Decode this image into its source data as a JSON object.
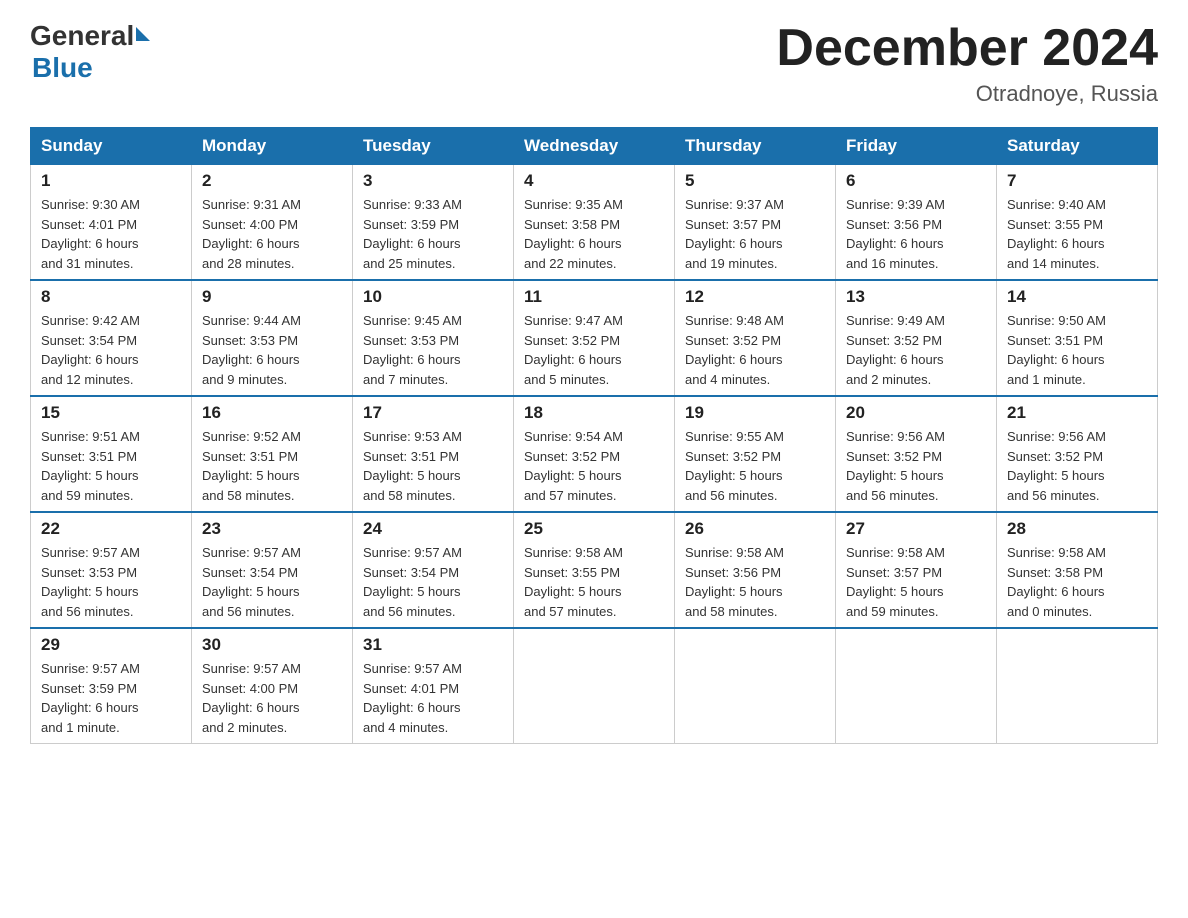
{
  "header": {
    "logo_general": "General",
    "logo_blue": "Blue",
    "month_title": "December 2024",
    "location": "Otradnoye, Russia"
  },
  "weekdays": [
    "Sunday",
    "Monday",
    "Tuesday",
    "Wednesday",
    "Thursday",
    "Friday",
    "Saturday"
  ],
  "weeks": [
    [
      {
        "day": "1",
        "sunrise": "9:30 AM",
        "sunset": "4:01 PM",
        "daylight": "6 hours and 31 minutes."
      },
      {
        "day": "2",
        "sunrise": "9:31 AM",
        "sunset": "4:00 PM",
        "daylight": "6 hours and 28 minutes."
      },
      {
        "day": "3",
        "sunrise": "9:33 AM",
        "sunset": "3:59 PM",
        "daylight": "6 hours and 25 minutes."
      },
      {
        "day": "4",
        "sunrise": "9:35 AM",
        "sunset": "3:58 PM",
        "daylight": "6 hours and 22 minutes."
      },
      {
        "day": "5",
        "sunrise": "9:37 AM",
        "sunset": "3:57 PM",
        "daylight": "6 hours and 19 minutes."
      },
      {
        "day": "6",
        "sunrise": "9:39 AM",
        "sunset": "3:56 PM",
        "daylight": "6 hours and 16 minutes."
      },
      {
        "day": "7",
        "sunrise": "9:40 AM",
        "sunset": "3:55 PM",
        "daylight": "6 hours and 14 minutes."
      }
    ],
    [
      {
        "day": "8",
        "sunrise": "9:42 AM",
        "sunset": "3:54 PM",
        "daylight": "6 hours and 12 minutes."
      },
      {
        "day": "9",
        "sunrise": "9:44 AM",
        "sunset": "3:53 PM",
        "daylight": "6 hours and 9 minutes."
      },
      {
        "day": "10",
        "sunrise": "9:45 AM",
        "sunset": "3:53 PM",
        "daylight": "6 hours and 7 minutes."
      },
      {
        "day": "11",
        "sunrise": "9:47 AM",
        "sunset": "3:52 PM",
        "daylight": "6 hours and 5 minutes."
      },
      {
        "day": "12",
        "sunrise": "9:48 AM",
        "sunset": "3:52 PM",
        "daylight": "6 hours and 4 minutes."
      },
      {
        "day": "13",
        "sunrise": "9:49 AM",
        "sunset": "3:52 PM",
        "daylight": "6 hours and 2 minutes."
      },
      {
        "day": "14",
        "sunrise": "9:50 AM",
        "sunset": "3:51 PM",
        "daylight": "6 hours and 1 minute."
      }
    ],
    [
      {
        "day": "15",
        "sunrise": "9:51 AM",
        "sunset": "3:51 PM",
        "daylight": "5 hours and 59 minutes."
      },
      {
        "day": "16",
        "sunrise": "9:52 AM",
        "sunset": "3:51 PM",
        "daylight": "5 hours and 58 minutes."
      },
      {
        "day": "17",
        "sunrise": "9:53 AM",
        "sunset": "3:51 PM",
        "daylight": "5 hours and 58 minutes."
      },
      {
        "day": "18",
        "sunrise": "9:54 AM",
        "sunset": "3:52 PM",
        "daylight": "5 hours and 57 minutes."
      },
      {
        "day": "19",
        "sunrise": "9:55 AM",
        "sunset": "3:52 PM",
        "daylight": "5 hours and 56 minutes."
      },
      {
        "day": "20",
        "sunrise": "9:56 AM",
        "sunset": "3:52 PM",
        "daylight": "5 hours and 56 minutes."
      },
      {
        "day": "21",
        "sunrise": "9:56 AM",
        "sunset": "3:52 PM",
        "daylight": "5 hours and 56 minutes."
      }
    ],
    [
      {
        "day": "22",
        "sunrise": "9:57 AM",
        "sunset": "3:53 PM",
        "daylight": "5 hours and 56 minutes."
      },
      {
        "day": "23",
        "sunrise": "9:57 AM",
        "sunset": "3:54 PM",
        "daylight": "5 hours and 56 minutes."
      },
      {
        "day": "24",
        "sunrise": "9:57 AM",
        "sunset": "3:54 PM",
        "daylight": "5 hours and 56 minutes."
      },
      {
        "day": "25",
        "sunrise": "9:58 AM",
        "sunset": "3:55 PM",
        "daylight": "5 hours and 57 minutes."
      },
      {
        "day": "26",
        "sunrise": "9:58 AM",
        "sunset": "3:56 PM",
        "daylight": "5 hours and 58 minutes."
      },
      {
        "day": "27",
        "sunrise": "9:58 AM",
        "sunset": "3:57 PM",
        "daylight": "5 hours and 59 minutes."
      },
      {
        "day": "28",
        "sunrise": "9:58 AM",
        "sunset": "3:58 PM",
        "daylight": "6 hours and 0 minutes."
      }
    ],
    [
      {
        "day": "29",
        "sunrise": "9:57 AM",
        "sunset": "3:59 PM",
        "daylight": "6 hours and 1 minute."
      },
      {
        "day": "30",
        "sunrise": "9:57 AM",
        "sunset": "4:00 PM",
        "daylight": "6 hours and 2 minutes."
      },
      {
        "day": "31",
        "sunrise": "9:57 AM",
        "sunset": "4:01 PM",
        "daylight": "6 hours and 4 minutes."
      },
      null,
      null,
      null,
      null
    ]
  ],
  "labels": {
    "sunrise": "Sunrise:",
    "sunset": "Sunset:",
    "daylight": "Daylight:"
  }
}
